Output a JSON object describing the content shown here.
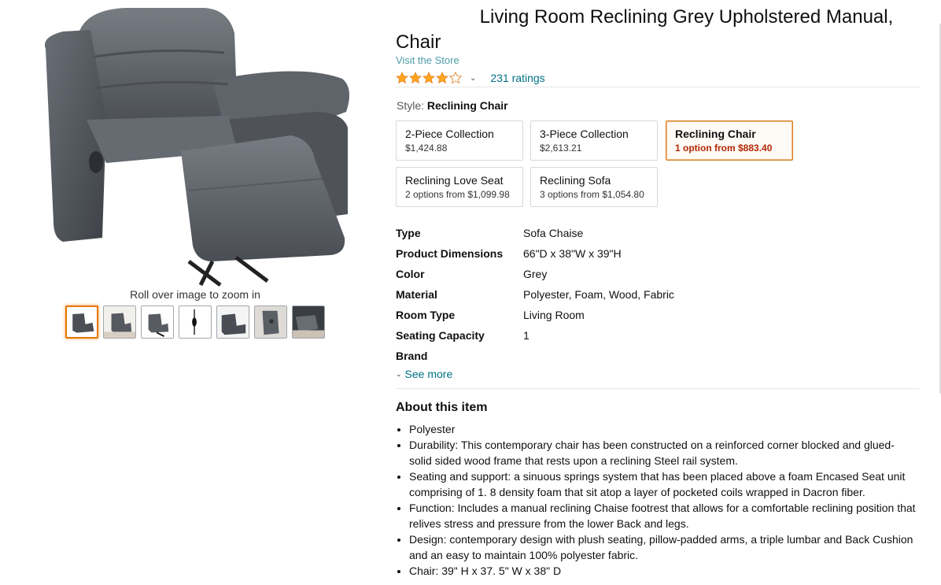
{
  "gallery": {
    "zoom_hint": "Roll over image to zoom in",
    "thumbnails": [
      "recliner-front",
      "recliner-room",
      "recliner-side",
      "remote-cord",
      "recliner-angle",
      "recliner-detail",
      "recliner-closeup"
    ]
  },
  "product": {
    "title": "Living Room Reclining Grey Upholstered Manual, Chair",
    "store_link": "Visit the Store",
    "rating_icon": "star-rating-icon",
    "rating_value": 4,
    "ratings_count": "231 ratings"
  },
  "style": {
    "label": "Style:",
    "selected": "Reclining Chair",
    "options": [
      {
        "name": "2-Piece Collection",
        "price": "$1,424.88"
      },
      {
        "name": "3-Piece Collection",
        "price": "$2,613.21"
      },
      {
        "name": "Reclining Chair",
        "price": "1 option from $883.40"
      },
      {
        "name": "Reclining Love Seat",
        "price": "2 options from $1,099.98"
      },
      {
        "name": "Reclining Sofa",
        "price": "3 options from $1,054.80"
      }
    ]
  },
  "specs": [
    {
      "key": "Type",
      "value": "Sofa Chaise"
    },
    {
      "key": "Product Dimensions",
      "value": "66\"D x 38\"W x 39\"H"
    },
    {
      "key": "Color",
      "value": "Grey"
    },
    {
      "key": "Material",
      "value": "Polyester, Foam, Wood, Fabric"
    },
    {
      "key": "Room Type",
      "value": "Living Room"
    },
    {
      "key": "Seating Capacity",
      "value": "1"
    },
    {
      "key": "Brand",
      "value": ""
    }
  ],
  "see_more": "See more",
  "about": {
    "title": "About this item",
    "bullets": [
      "Polyester",
      "Durability: This contemporary chair has been constructed on a reinforced corner blocked and glued-solid sided wood frame that rests upon a reclining Steel rail system.",
      "Seating and support: a sinuous springs system that has been placed above a foam Encased Seat unit comprising of 1. 8 density foam that sit atop a layer of pocketed coils wrapped in Dacron fiber.",
      "Function: Includes a manual reclining Chaise footrest that allows for a comfortable reclining position that relives stress and pressure from the lower Back and legs.",
      "Design: contemporary design with plush seating, pillow-padded arms, a triple lumbar and Back Cushion and an easy to maintain 100% polyester fabric.",
      "Chair: 39\" H x 37. 5\" W x 38\" D"
    ]
  },
  "colors": {
    "link": "#007185",
    "accent": "#e77600",
    "price_red": "#b12704",
    "star": "#ffa41c"
  }
}
